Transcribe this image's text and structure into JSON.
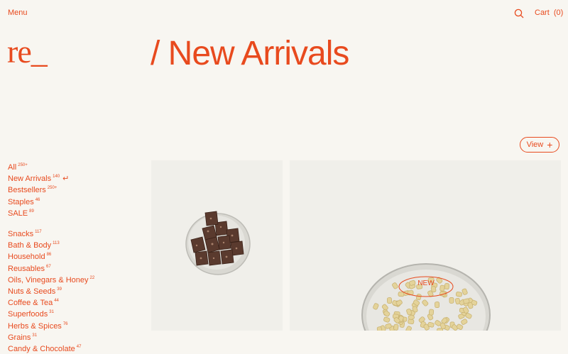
{
  "header": {
    "menu_label": "Menu",
    "cart_label": "Cart",
    "cart_count": "(0)"
  },
  "logo": {
    "text": "re_"
  },
  "page": {
    "title": "/ New Arrivals"
  },
  "view_button": {
    "label": "View",
    "icon": "plus-icon"
  },
  "categories": {
    "group1": [
      {
        "label": "All",
        "count": "250+"
      },
      {
        "label": "New Arrivals",
        "count": "140",
        "active": true
      },
      {
        "label": "Bestsellers",
        "count": "250+"
      },
      {
        "label": "Staples",
        "count": "46"
      },
      {
        "label": "SALE",
        "count": "89"
      }
    ],
    "group2": [
      {
        "label": "Snacks",
        "count": "117"
      },
      {
        "label": "Bath & Body",
        "count": "113"
      },
      {
        "label": "Household",
        "count": "86"
      },
      {
        "label": "Reusables",
        "count": "67"
      },
      {
        "label": "Oils, Vinegars & Honey",
        "count": "22"
      },
      {
        "label": "Nuts & Seeds",
        "count": "39"
      },
      {
        "label": "Coffee & Tea",
        "count": "44"
      },
      {
        "label": "Superfoods",
        "count": "31"
      },
      {
        "label": "Herbs & Spices",
        "count": "76"
      },
      {
        "label": "Grains",
        "count": "31"
      },
      {
        "label": "Candy & Chocolate",
        "count": "47"
      }
    ]
  },
  "products": {
    "card2_badge": "NEW"
  },
  "colors": {
    "accent": "#e84a1e",
    "background": "#f8f6f1",
    "card": "#f0efea"
  }
}
